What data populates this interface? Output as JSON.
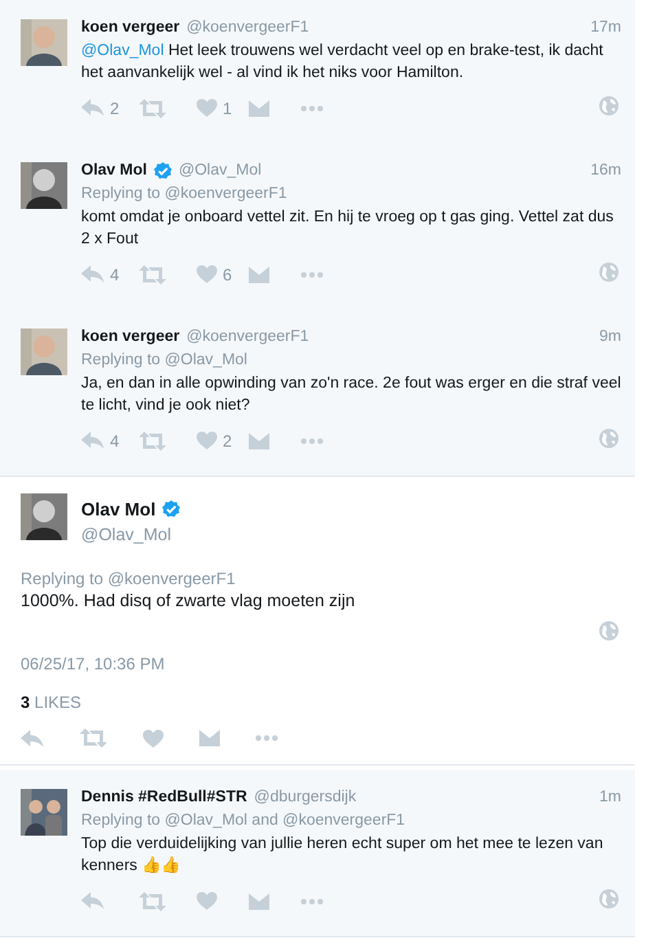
{
  "replies_above": [
    {
      "name": "koen vergeer",
      "handle": "@koenvergeerF1",
      "time": "17m",
      "mention": "@Olav_Mol",
      "text": "Het leek trouwens wel verdacht veel op en brake-test, ik dacht het aanvankelijk wel - al vind ik het niks voor Hamilton.",
      "reply_count": "2",
      "like_count": "1"
    },
    {
      "name": "Olav Mol",
      "handle": "@Olav_Mol",
      "verified": true,
      "time": "16m",
      "replying_to": "Replying to @koenvergeerF1",
      "text": "komt omdat je onboard vettel zit. En hij te vroeg op t gas ging. Vettel zat dus 2 x Fout",
      "reply_count": "4",
      "like_count": "6"
    },
    {
      "name": "koen vergeer",
      "handle": "@koenvergeerF1",
      "time": "9m",
      "replying_to": "Replying to @Olav_Mol",
      "text": "Ja, en dan in alle opwinding van zo'n race. 2e fout was erger en die straf veel te licht, vind je ook niet?",
      "reply_count": "4",
      "like_count": "2"
    }
  ],
  "main_tweet": {
    "name": "Olav Mol",
    "handle": "@Olav_Mol",
    "verified": true,
    "replying_to": "Replying to @koenvergeerF1",
    "text": "1000%. Had disq of zwarte vlag moeten zijn",
    "date": "06/25/17, 10:36 PM",
    "likes_count": "3",
    "likes_label": "LIKES"
  },
  "replies_below": [
    {
      "name": "Dennis #RedBull#STR",
      "handle": "@dburgersdijk",
      "time": "1m",
      "replying_to": "Replying to @Olav_Mol and @koenvergeerF1",
      "text": "Top die verduidelijking van jullie heren echt super om het mee te lezen van kenners 👍👍"
    }
  ]
}
